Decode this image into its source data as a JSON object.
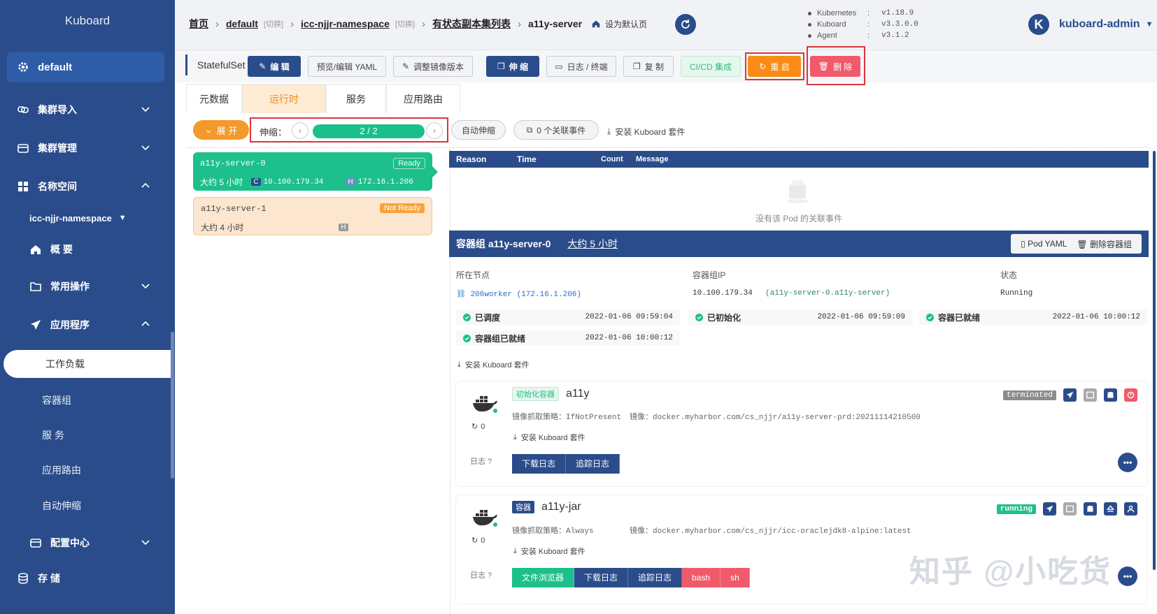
{
  "sidebar": {
    "brand": "Kuboard",
    "cluster": "default",
    "groups": {
      "import": "集群导入",
      "manage": "集群管理",
      "namespace": "名称空间",
      "ns_name": "icc-njjr-namespace",
      "overview": "概 要",
      "common": "常用操作",
      "apps": "应用程序",
      "config": "配置中心",
      "storage": "存 储"
    },
    "leaves": {
      "workload": "工作负载",
      "pods": "容器组",
      "services": "服 务",
      "ingress": "应用路由",
      "autoscale": "自动伸缩"
    }
  },
  "topbar": {
    "crumb_home": "首页",
    "crumb_cluster": "default",
    "crumb_switch": "[切换]",
    "crumb_ns": "icc-njjr-namespace",
    "crumb_list": "有状态副本集列表",
    "crumb_current": "a11y-server",
    "set_default": "设为默认页",
    "versions": [
      {
        "k": "Kubernetes",
        "v": "v1.18.9"
      },
      {
        "k": "Kuboard",
        "v": "v3.3.0.0"
      },
      {
        "k": "Agent",
        "v": "v3.1.2"
      }
    ],
    "user_initial": "K",
    "user": "kuboard-admin"
  },
  "actions": {
    "kind": "StatefulSet",
    "edit": "编 辑",
    "yaml": "预览/编辑 YAML",
    "image": "调整镜像版本",
    "scale": "伸 缩",
    "logs": "日志 / 终端",
    "copy": "复 制",
    "cicd": "CI/CD 集成",
    "restart": "重 启",
    "delete": "删 除"
  },
  "tabs": [
    "元数据",
    "运行时",
    "服务",
    "应用路由"
  ],
  "controls": {
    "expand": "展 开",
    "scale_label": "伸缩：",
    "scale_value": "2 / 2",
    "autoscale": "自动伸缩",
    "events": "0 个关联事件",
    "install": "安装 Kuboard 套件"
  },
  "pods": [
    {
      "name": "a11y-server-0",
      "status": "Ready",
      "age": "大约 5 小时",
      "ip_c": "10.100.179.34",
      "ip_h": "172.16.1.206"
    },
    {
      "name": "a11y-server-1",
      "status": "Not Ready",
      "age": "大约 4 小时"
    }
  ],
  "events": {
    "headers": [
      "Reason",
      "Time",
      "Count",
      "Message"
    ],
    "empty": "没有该 Pod 的关联事件"
  },
  "podgroup": {
    "title": "容器组  a11y-server-0",
    "age": "大约 5 小时",
    "yaml_btn": "Pod YAML",
    "delete_btn": "删除容器组",
    "node_label": "所在节点",
    "node_value": "206worker  (172.16.1.206)",
    "ip_label": "容器组IP",
    "ip_value": "10.100.179.34",
    "ip_dns": "(a11y-server-0.a11y-server)",
    "state_label": "状态",
    "state_value": "Running",
    "conds": [
      {
        "name": "已调度",
        "time": "2022-01-06 09:59:04"
      },
      {
        "name": "已初始化",
        "time": "2022-01-06 09:59:09"
      },
      {
        "name": "容器已就绪",
        "time": "2022-01-06 10:00:12"
      },
      {
        "name": "容器组已就绪",
        "time": "2022-01-06 10:00:12"
      }
    ],
    "install": "安装 Kuboard 套件"
  },
  "containers": [
    {
      "tag": "初始化容器",
      "name": "a11y",
      "state": "terminated",
      "policy": "镜像抓取策略：IfNotPresent",
      "image": "镜像：docker.myharbor.com/cs_njjr/a11y-server-prd:20211114210500",
      "restarts": "0",
      "install": "安装 Kuboard 套件",
      "log_label": "日志",
      "buttons": [
        "下载日志",
        "追踪日志"
      ]
    },
    {
      "tag": "容器",
      "name": "a11y-jar",
      "state": "running",
      "policy": "镜像抓取策略：Always",
      "image": "镜像：docker.myharbor.com/cs_njjr/icc-oraclejdk8-alpine:latest",
      "restarts": "0",
      "install": "安装 Kuboard 套件",
      "log_label": "日志",
      "buttons": [
        "文件浏览器",
        "下载日志",
        "追踪日志",
        "bash",
        "sh"
      ]
    }
  ],
  "watermark": "知乎 @小吃货",
  "colors": {
    "primary": "#2a4c8b",
    "success": "#1dbf8b",
    "warning": "#fa8c16",
    "danger": "#f05a6a"
  }
}
